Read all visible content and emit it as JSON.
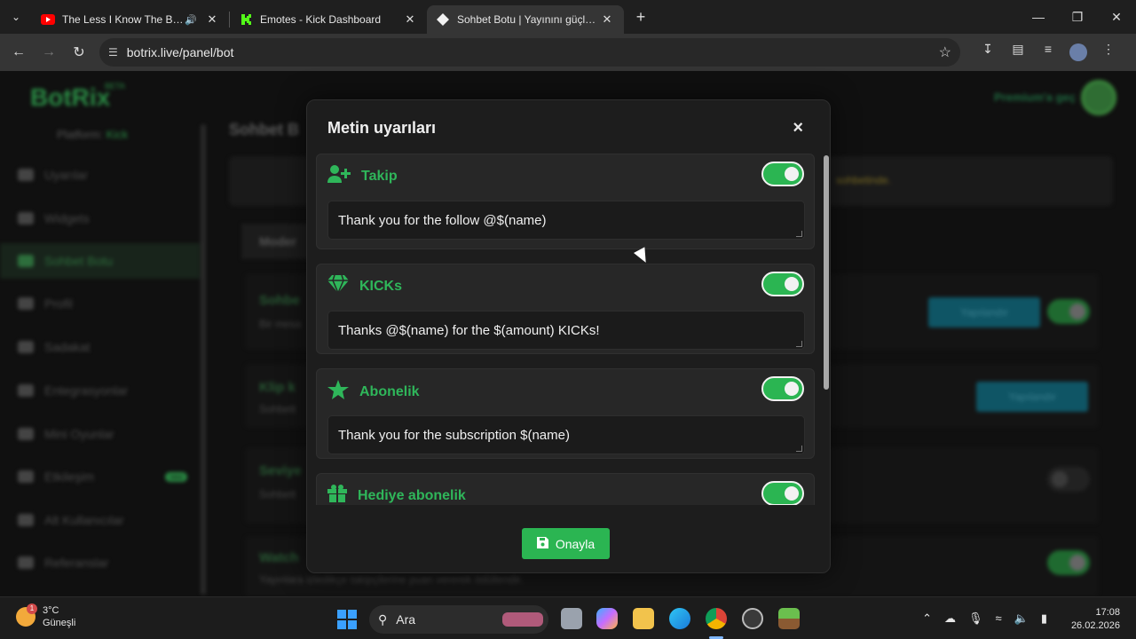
{
  "browser": {
    "tabs": [
      {
        "title": "The Less I Know The Better",
        "audio": true
      },
      {
        "title": "Emotes - Kick Dashboard",
        "audio": false
      },
      {
        "title": "Sohbet Botu | Yayınını güçlendir",
        "audio": false
      }
    ],
    "url": "botrix.live/panel/bot"
  },
  "app": {
    "brand": "BotRix",
    "beta": "BETA",
    "platform_label": "Platform:",
    "platform_value": "Kick",
    "premium": "Premium'a geç",
    "sidebar": [
      {
        "label": "Uyarılar"
      },
      {
        "label": "Widgets"
      },
      {
        "label": "Sohbet Botu",
        "active": true
      },
      {
        "label": "Profil"
      },
      {
        "label": "Sadakat"
      },
      {
        "label": "Entegrasyonlar"
      },
      {
        "label": "Mini Oyunlar"
      },
      {
        "label": "Etkileşim",
        "badge": "new"
      },
      {
        "label": "Alt Kullanıcılar"
      },
      {
        "label": "Referanslar"
      }
    ],
    "content_title": "Sohbet B",
    "info_text": "sohbetinde.",
    "tab_label": "Moder",
    "cards": [
      {
        "title": "Sohbe",
        "sub": "Bir mesa",
        "button": "Yapılandır"
      },
      {
        "title": "Klip k",
        "sub": "Sohbett",
        "button": "Yapılandır"
      },
      {
        "title": "Seviye",
        "sub": "Sohbett"
      },
      {
        "title": "Watch",
        "sub": "Yayınlara izledikçe takipçilerine puan vererek ödüllendir."
      }
    ]
  },
  "modal": {
    "title": "Metin uyarıları",
    "close": "×",
    "alerts": [
      {
        "name": "Takip",
        "icon": "user-plus-icon",
        "enabled": true,
        "text": "Thank you for the follow @$(name)"
      },
      {
        "name": "KICKs",
        "icon": "gem-icon",
        "enabled": true,
        "text": "Thanks @$(name) for the $(amount) KICKs!"
      },
      {
        "name": "Abonelik",
        "icon": "star-icon",
        "enabled": true,
        "text": "Thank you for the subscription $(name)"
      },
      {
        "name": "Hediye abonelik",
        "icon": "gift-icon",
        "enabled": true,
        "text": ""
      }
    ],
    "confirm": "Onayla"
  },
  "taskbar": {
    "temperature": "3°C",
    "weather": "Güneşli",
    "weather_badge": "1",
    "search": "Ara",
    "time": "17:08",
    "date": "26.02.2026"
  },
  "colors": {
    "accent": "#2bb552",
    "modal_bg": "#1d1d1d",
    "card_bg": "#272727"
  }
}
